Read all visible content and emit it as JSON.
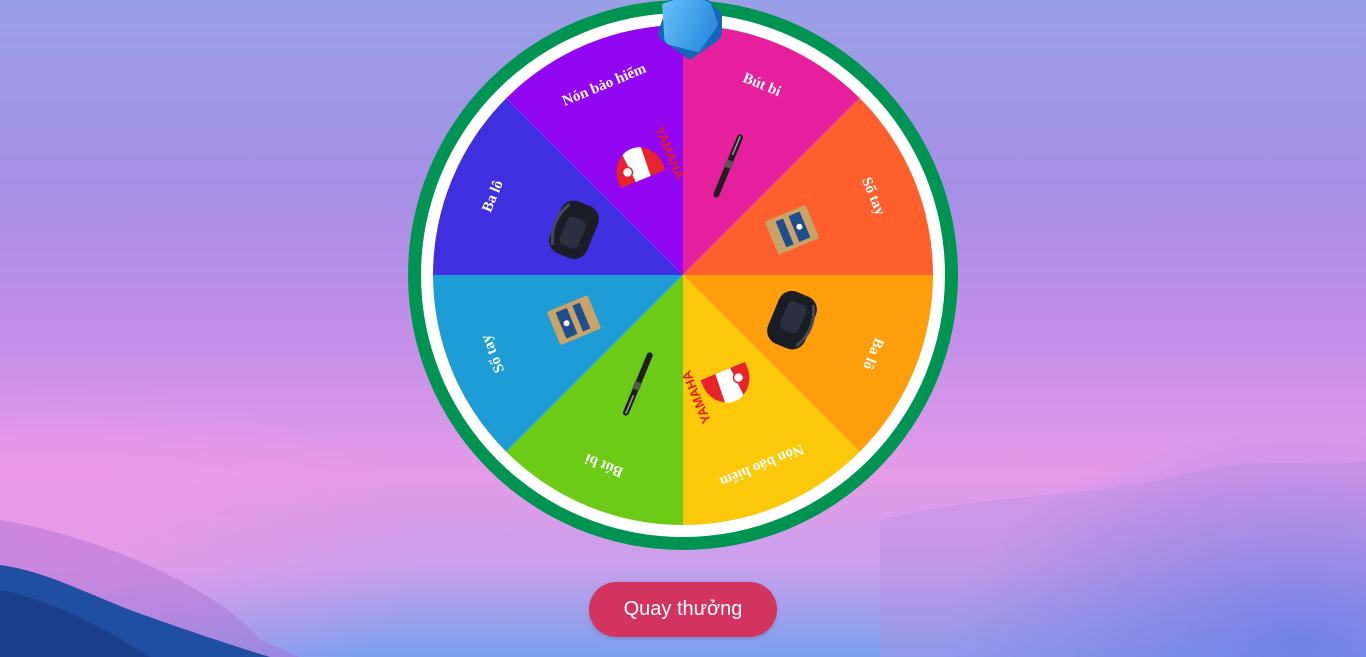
{
  "wheel": {
    "segments": [
      {
        "label": "Bút bi",
        "color": "#e61f9c",
        "prize_icon": "pen-icon"
      },
      {
        "label": "Sổ tay",
        "color": "#ff5f2d",
        "prize_icon": "notebook-icon"
      },
      {
        "label": "Ba lô",
        "color": "#ff9e0b",
        "prize_icon": "backpack-icon"
      },
      {
        "label": "Nón bảo hiểm",
        "color": "#fcc80a",
        "prize_icon": "helmet-icon"
      },
      {
        "label": "Bút bi",
        "color": "#6ccb17",
        "prize_icon": "pen-icon"
      },
      {
        "label": "Sổ tay",
        "color": "#1e9cd6",
        "prize_icon": "notebook-icon"
      },
      {
        "label": "Ba lô",
        "color": "#3e30e0",
        "prize_icon": "backpack-icon"
      },
      {
        "label": "Nón bảo hiểm",
        "color": "#9306f2",
        "prize_icon": "helmet-icon"
      }
    ],
    "helmet_brand": "YAMAHA",
    "rim_color": "#009453",
    "pointer_icon": "pointer-arrow-icon"
  },
  "spin_button": {
    "label": "Quay thưởng",
    "color": "#d2335f"
  }
}
